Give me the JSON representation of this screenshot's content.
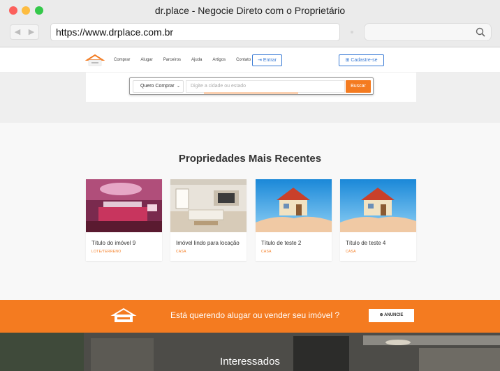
{
  "window": {
    "title": "dr.place - Negocie Direto com o Proprietário",
    "url": "https://www.drplace.com.br"
  },
  "nav": {
    "items": [
      "Comprar",
      "Alugar",
      "Parceiros",
      "Ajuda",
      "Artigos",
      "Contato"
    ],
    "login": "Entrar",
    "signup": "Cadastre-se"
  },
  "search": {
    "mode": "Quero Comprar",
    "placeholder": "Digite a cidade ou estado",
    "button": "Buscar"
  },
  "recent": {
    "title": "Propriedades Mais Recentes",
    "cards": [
      {
        "title": "Título do imóvel 9",
        "type": "LOTE/TERRENO",
        "image": "bedroom-photo"
      },
      {
        "title": "Imóvel lindo para locação",
        "type": "CASA",
        "image": "living-room-photo"
      },
      {
        "title": "Título de teste 2",
        "type": "CASA",
        "image": "house-in-hands-photo"
      },
      {
        "title": "Título de teste 4",
        "type": "CASA",
        "image": "house-in-hands-photo"
      }
    ]
  },
  "cta": {
    "text": "Está querendo alugar ou vender seu imóvel ?",
    "button": "ANUNCIE"
  },
  "interest": {
    "title": "Interessados"
  },
  "colors": {
    "accent": "#f47b20",
    "link": "#3a7bd5"
  }
}
